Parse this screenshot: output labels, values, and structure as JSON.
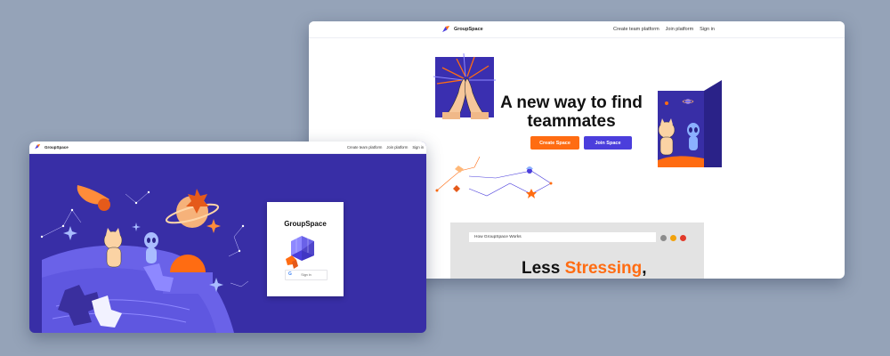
{
  "landing": {
    "nav": {
      "brand": "GroupSpace",
      "links": [
        "Create team platform",
        "Join platform",
        "Sign in"
      ]
    },
    "hero": {
      "title_line1": "A new way to find",
      "title_line2": "teammates",
      "create_button": "Create Space",
      "join_button": "Join Space"
    },
    "preview": {
      "bar_text": "How GroupSpace Works",
      "headline_plain": "Less ",
      "headline_accent": "Stressing",
      "headline_tail": ",",
      "dot_colors": [
        "#8c8c8c",
        "#f2a20c",
        "#e23a2a"
      ]
    }
  },
  "signin": {
    "nav": {
      "brand": "GroupSpace",
      "links": [
        "Create team platform",
        "Join platform",
        "Sign in"
      ]
    },
    "card": {
      "title": "GroupSpace",
      "google_glyph": "G",
      "button_label": "Sign in"
    }
  },
  "colors": {
    "background": "#95a3b8",
    "accent_orange": "#ff6c12",
    "accent_purple": "#4b3edc",
    "space_blue": "#382ea6"
  },
  "icons": [
    "groupspace-logo-icon",
    "google-icon"
  ]
}
